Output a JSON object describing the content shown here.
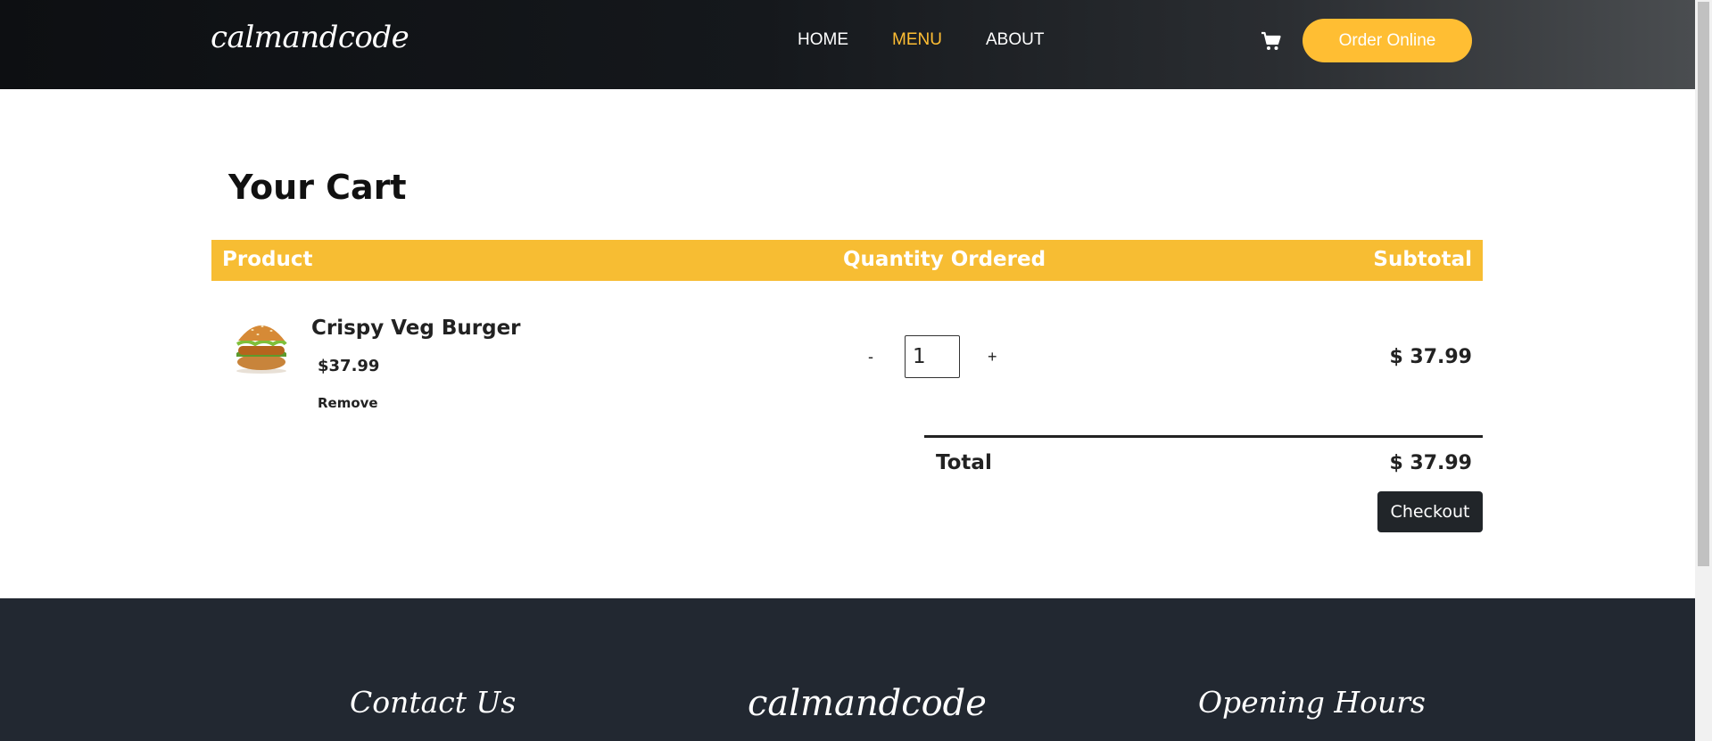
{
  "header": {
    "logo": "calmandcode",
    "nav": [
      {
        "label": "HOME",
        "active": false
      },
      {
        "label": "MENU",
        "active": true
      },
      {
        "label": "ABOUT",
        "active": false
      }
    ],
    "cart_icon": "shopping-cart-icon",
    "order_button": "Order Online"
  },
  "cart": {
    "title": "Your Cart",
    "columns": {
      "product": "Product",
      "quantity": "Quantity Ordered",
      "subtotal": "Subtotal"
    },
    "items": [
      {
        "name": "Crispy Veg Burger",
        "price": "$37.99",
        "remove_label": "Remove",
        "decrement": "-",
        "quantity": "1",
        "increment": "+",
        "subtotal": "$ 37.99",
        "image": "burger-image"
      }
    ],
    "total_label": "Total",
    "total_value": "$ 37.99",
    "checkout_button": "Checkout"
  },
  "footer": {
    "contact_heading": "Contact Us",
    "logo": "calmandcode",
    "hours_heading": "Opening Hours"
  },
  "colors": {
    "accent": "#ffbe33",
    "table_header": "#f7bd33",
    "footer_bg": "#222831",
    "checkout_bg": "#212529"
  }
}
